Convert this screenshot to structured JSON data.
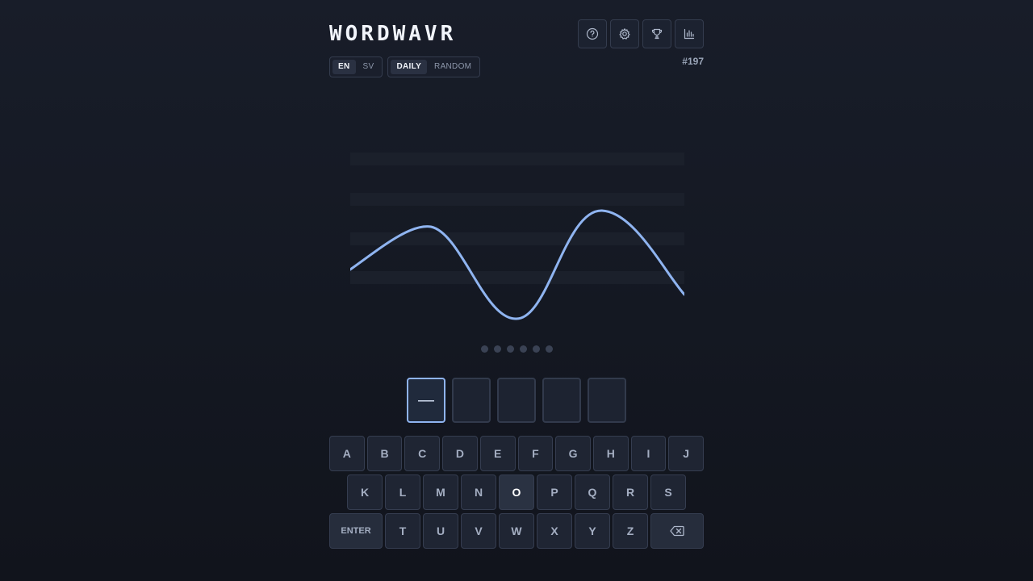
{
  "app": {
    "title": "WORDWAVR",
    "puzzle_number": "#197"
  },
  "header_icons": [
    {
      "name": "help-icon"
    },
    {
      "name": "gear-icon"
    },
    {
      "name": "trophy-icon"
    },
    {
      "name": "stats-icon"
    }
  ],
  "language_toggle": {
    "options": [
      "EN",
      "SV"
    ],
    "selected": "EN"
  },
  "mode_toggle": {
    "options": [
      "DAILY",
      "RANDOM"
    ],
    "selected": "DAILY"
  },
  "wave": {
    "color": "#8fb4f0",
    "guide_color": "#1c2230"
  },
  "attempts": {
    "total": 6,
    "used": 0
  },
  "answer_slots": {
    "count": 5,
    "active_index": 0,
    "active_placeholder": "—",
    "values": [
      "",
      "",
      "",
      "",
      ""
    ]
  },
  "keyboard": {
    "rows": [
      [
        "A",
        "B",
        "C",
        "D",
        "E",
        "F",
        "G",
        "H",
        "I",
        "J"
      ],
      [
        "K",
        "L",
        "M",
        "N",
        "O",
        "P",
        "Q",
        "R",
        "S"
      ],
      [
        "ENTER",
        "T",
        "U",
        "V",
        "W",
        "X",
        "Y",
        "Z",
        "BACKSPACE"
      ]
    ],
    "highlighted_keys": [
      "O"
    ],
    "enter_label": "ENTER",
    "backspace_icon": "backspace-icon"
  },
  "colors": {
    "accent": "#8fb4f0",
    "background": "#161b26"
  }
}
